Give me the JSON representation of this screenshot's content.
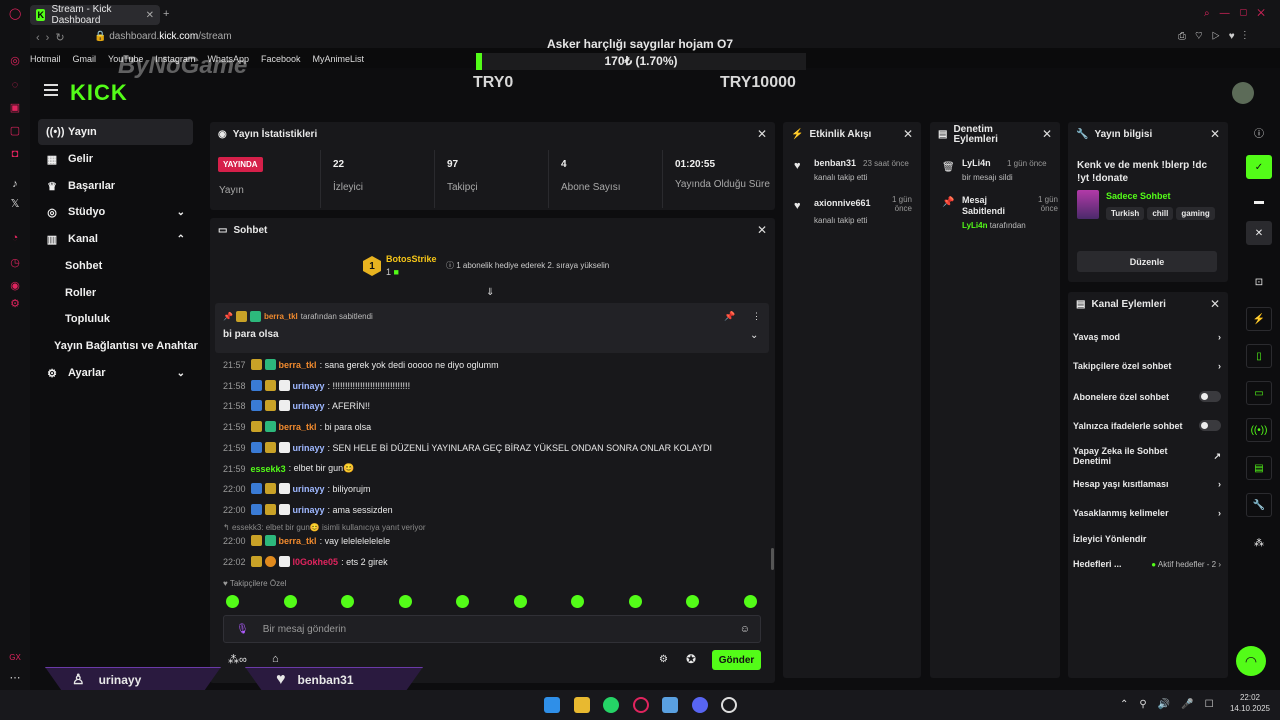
{
  "browser": {
    "tab_title": "Stream - Kick Dashboard",
    "tab_add": "+",
    "url_prefix": "dashboard.",
    "url_domain": "kick.com",
    "url_path": "/stream",
    "bookmarks": [
      "Hotmail",
      "Gmail",
      "YouTube",
      "Instagram",
      "WhatsApp",
      "Facebook",
      "MyAnimeList"
    ]
  },
  "overlay": {
    "title": "Asker harçlığı saygılar hojam O7",
    "progress_text": "170₺ (1.70%)",
    "progress_fraction": 0.017,
    "goal_min": "TRY0",
    "goal_max": "TRY10000",
    "watermark": "ByNoGame"
  },
  "app": {
    "logo": "KICK"
  },
  "sidebar": {
    "items": [
      {
        "label": "Yayın",
        "icon": "broadcast-icon"
      },
      {
        "label": "Gelir",
        "icon": "revenue-icon"
      },
      {
        "label": "Başarılar",
        "icon": "trophy-icon"
      },
      {
        "label": "Stüdyo",
        "icon": "studio-icon"
      },
      {
        "label": "Kanal",
        "icon": "channel-icon"
      },
      {
        "label": "Ayarlar",
        "icon": "gear-icon"
      }
    ],
    "sub": [
      "Sohbet",
      "Roller",
      "Topluluk",
      "Yayın Bağlantısı ve Anahtar"
    ]
  },
  "stats": {
    "title": "Yayın İstatistikleri",
    "live_badge": "YAYINDA",
    "live_label": "Yayın",
    "items": [
      {
        "value": "22",
        "label": "İzleyici"
      },
      {
        "value": "97",
        "label": "Takipçi"
      },
      {
        "value": "4",
        "label": "Abone Sayısı"
      },
      {
        "value": "01:20:55",
        "label": "Yayında Olduğu Süre"
      }
    ]
  },
  "chat": {
    "title": "Sohbet",
    "gifter_name": "BotosStrike",
    "gifter_rank": "1",
    "gifter_count": "1",
    "gift_text": "1 abonelik hediye ederek 2. sıraya yükselin",
    "pinned_by": "berra_tkl",
    "pinned_suffix": "tarafından sabitlendi",
    "pinned_message": "bi para olsa",
    "messages": [
      {
        "time": "21:57",
        "user": "berra_tkl",
        "text": ": sana gerek yok dedi ooooo ne diyo oglumm",
        "color": "#f08a2e"
      },
      {
        "time": "21:58",
        "user": "urinayy",
        "text": ": !!!!!!!!!!!!!!!!!!!!!!!!!!!!!!!",
        "color": "#9fb8ff"
      },
      {
        "time": "21:58",
        "user": "urinayy",
        "text": ": AFERİN!!",
        "color": "#9fb8ff"
      },
      {
        "time": "21:59",
        "user": "berra_tkl",
        "text": ": bi para olsa",
        "color": "#f08a2e"
      },
      {
        "time": "21:59",
        "user": "urinayy",
        "text": ": SEN HELE Bİ DÜZENLİ YAYINLARA GEÇ BİRAZ YÜKSEL ONDAN SONRA ONLAR KOLAYDI",
        "color": "#9fb8ff"
      },
      {
        "time": "21:59",
        "user": "essekk3",
        "text": ": elbet bir gun😊",
        "color": "#53fc18"
      },
      {
        "time": "22:00",
        "user": "urinayy",
        "text": ": biliyorujm",
        "color": "#9fb8ff"
      },
      {
        "time": "22:00",
        "user": "urinayy",
        "text": ": ama sessizden",
        "color": "#9fb8ff"
      },
      {
        "time": "22:00",
        "user": "berra_tkl",
        "text": ": vay lelelelelelele",
        "color": "#f08a2e"
      },
      {
        "time": "22:02",
        "user": "l0Gokhe05",
        "text": ": ets 2 girek",
        "color": "#e0245e"
      }
    ],
    "reply_text": "essekk3: elbet bir gun😊 isimli kullanıcıya yanıt veriyor",
    "followers_only": "Takipçilere Özel",
    "input_placeholder": "Bir mesaj gönderin",
    "send": "Gönder"
  },
  "events": {
    "title": "Etkinlik Akışı",
    "items": [
      {
        "user": "benban31",
        "time": "23 saat önce",
        "text": "kanalı takip etti"
      },
      {
        "user": "axionnive661",
        "time": "1 gün önce",
        "text": "kanalı takip etti"
      }
    ]
  },
  "mod": {
    "title": "Denetim Eylemleri",
    "items": [
      {
        "user": "LyLi4n",
        "time": "1 gün önce",
        "text": "bir mesajı sildi"
      },
      {
        "user": "Mesaj Sabitlendi",
        "time": "1 gün önce",
        "by": "LyLi4n",
        "by_suffix": "tarafından"
      }
    ]
  },
  "stream_info": {
    "title": "Yayın bilgisi",
    "stream_title": "Kenk ve de menk !blerp !dc !yt !donate",
    "category": "Sadece Sohbet",
    "tags": [
      "Turkish",
      "chill",
      "gaming"
    ],
    "edit": "Düzenle"
  },
  "channel_actions": {
    "title": "Kanal Eylemleri",
    "items": [
      {
        "label": "Yavaş mod",
        "kind": "chevron"
      },
      {
        "label": "Takipçilere özel sohbet",
        "kind": "chevron"
      },
      {
        "label": "Abonelere özel sohbet",
        "kind": "toggle"
      },
      {
        "label": "Yalnızca ifadelerle sohbet",
        "kind": "toggle"
      },
      {
        "label": "Yapay Zeka ile Sohbet Denetimi",
        "kind": "external"
      },
      {
        "label": "Hesap yaşı kısıtlaması",
        "kind": "chevron"
      },
      {
        "label": "Yasaklanmış kelimeler",
        "kind": "chevron"
      },
      {
        "label": "İzleyici Yönlendir",
        "kind": "none"
      }
    ],
    "goals_label": "Hedefleri ...",
    "goals_value": "Aktif hedefler - 2"
  },
  "alerts": {
    "left_user": "urinayy",
    "right_user": "benban31"
  },
  "taskbar": {
    "time": "22:02",
    "date": "14.10.2025"
  }
}
